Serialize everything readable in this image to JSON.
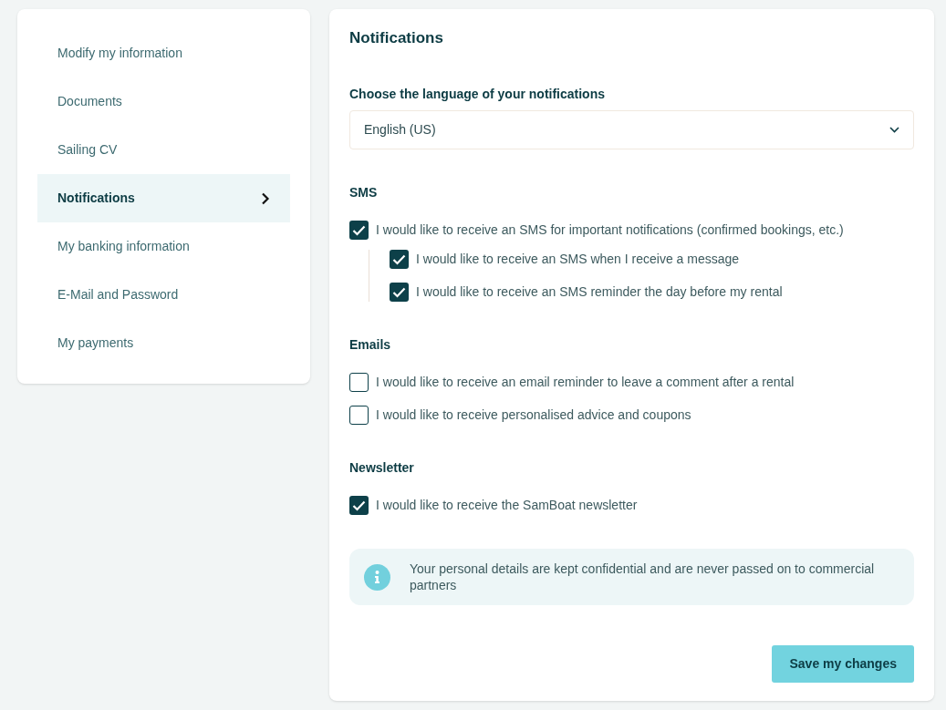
{
  "sidebar": {
    "items": [
      {
        "label": "Modify my information",
        "selected": false
      },
      {
        "label": "Documents",
        "selected": false
      },
      {
        "label": "Sailing CV",
        "selected": false
      },
      {
        "label": "Notifications",
        "selected": true
      },
      {
        "label": "My banking information",
        "selected": false
      },
      {
        "label": "E-Mail and Password",
        "selected": false
      },
      {
        "label": "My payments",
        "selected": false
      }
    ]
  },
  "main": {
    "title": "Notifications",
    "language": {
      "label": "Choose the language of your notifications",
      "value": "English (US)"
    },
    "sections": [
      {
        "title": "SMS",
        "options": [
          {
            "label": "I would like to receive an SMS for important notifications (confirmed bookings, etc.)",
            "checked": true,
            "children": [
              {
                "label": "I would like to receive an SMS when I receive a message",
                "checked": true
              },
              {
                "label": "I would like to receive an SMS reminder the day before my rental",
                "checked": true
              }
            ]
          }
        ]
      },
      {
        "title": "Emails",
        "options": [
          {
            "label": "I would like to receive an email reminder to leave a comment after a rental",
            "checked": false
          },
          {
            "label": "I would like to receive personalised advice and coupons",
            "checked": false
          }
        ]
      },
      {
        "title": "Newsletter",
        "options": [
          {
            "label": "I would like to receive the SamBoat newsletter",
            "checked": true
          }
        ]
      }
    ],
    "info": "Your personal details are kept confidential and are never passed on to commercial partners",
    "save_button": "Save my changes"
  }
}
